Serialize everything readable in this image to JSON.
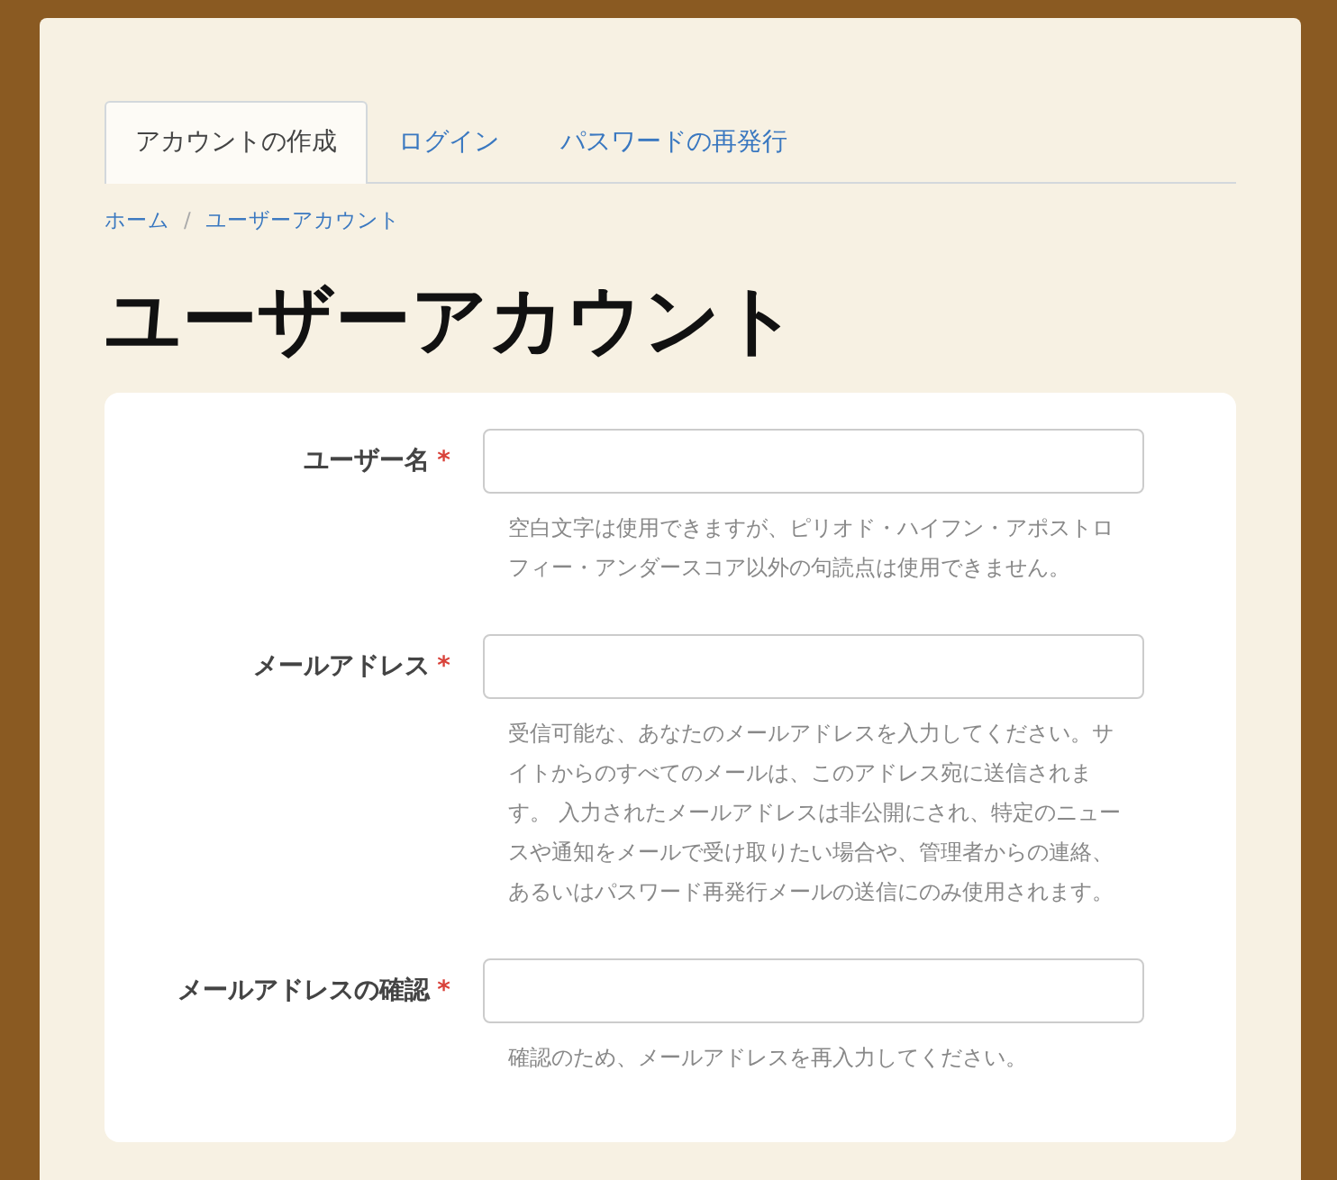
{
  "tabs": [
    {
      "label": "アカウントの作成",
      "selected": true
    },
    {
      "label": "ログイン",
      "selected": false
    },
    {
      "label": "パスワードの再発行",
      "selected": false
    }
  ],
  "breadcrumb": {
    "separator": "/",
    "items": [
      "ホーム",
      "ユーザーアカウント"
    ]
  },
  "title": "ユーザーアカウント",
  "fields": [
    {
      "label": "ユーザー名",
      "required_mark": "*",
      "help": "空白文字は使用できますが、ピリオド・ハイフン・アポストロフィー・アンダースコア以外の句読点は使用できません。"
    },
    {
      "label": "メールアドレス",
      "required_mark": "*",
      "help": "受信可能な、あなたのメールアドレスを入力してください。サイトからのすべてのメールは、このアドレス宛に送信されます。 入力されたメールアドレスは非公開にされ、特定のニュースや通知をメールで受け取りたい場合や、管理者からの連絡、あるいはパスワード再発行メールの送信にのみ使用されます。"
    },
    {
      "label": "メールアドレスの確認",
      "required_mark": "*",
      "help": "確認のため、メールアドレスを再入力してください。"
    }
  ]
}
